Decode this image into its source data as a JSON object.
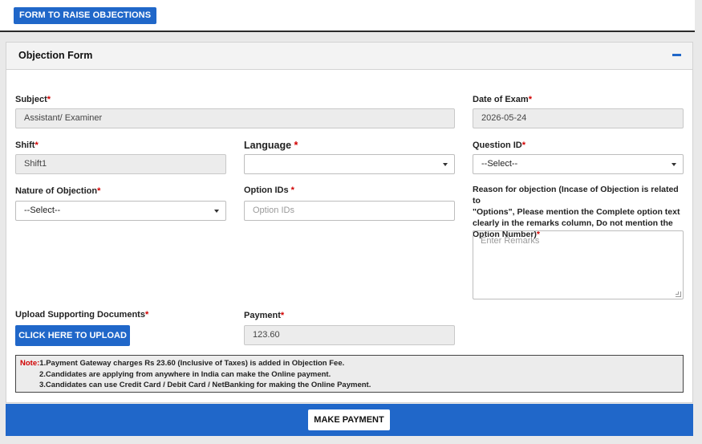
{
  "header": {
    "raise_button": "FORM TO RAISE OBJECTIONS"
  },
  "panel": {
    "title": "Objection Form",
    "collapse_icon": "minus-icon"
  },
  "form": {
    "subject": {
      "label": "Subject",
      "value": "Assistant/ Examiner"
    },
    "date_of_exam": {
      "label": "Date of Exam",
      "value": "2026-05-24"
    },
    "shift": {
      "label": "Shift",
      "value": "Shift1"
    },
    "language": {
      "label": "Language",
      "value": ""
    },
    "question_id": {
      "label": "Question ID",
      "value": "--Select--"
    },
    "nature_of_objection": {
      "label": "Nature of Objection",
      "value": "--Select--"
    },
    "option_ids": {
      "label": "Option IDs",
      "placeholder": "Option IDs"
    },
    "reason": {
      "label_lines": [
        "Reason for objection (Incase of Objection is related to",
        "\"Options\", Please mention the Complete option text",
        "clearly in the remarks column, Do not mention the",
        "Option Number)"
      ],
      "placeholder": "Enter Remarks"
    },
    "upload": {
      "label": "Upload Supporting Documents",
      "button": "CLICK HERE TO UPLOAD"
    },
    "payment": {
      "label": "Payment",
      "value": "123.60"
    },
    "required_mark": "*"
  },
  "note": {
    "label": "Note:",
    "lines": [
      "1.Payment Gateway charges Rs 23.60 (Inclusive of Taxes) is added in Objection Fee.",
      "2.Candidates are applying from anywhere in India can make the Online payment.",
      "3.Candidates can use Credit Card / Debit Card / NetBanking for making the Online Payment."
    ]
  },
  "footer": {
    "make_payment": "MAKE PAYMENT"
  },
  "colors": {
    "primary": "#2067c9",
    "required": "#d10000"
  }
}
